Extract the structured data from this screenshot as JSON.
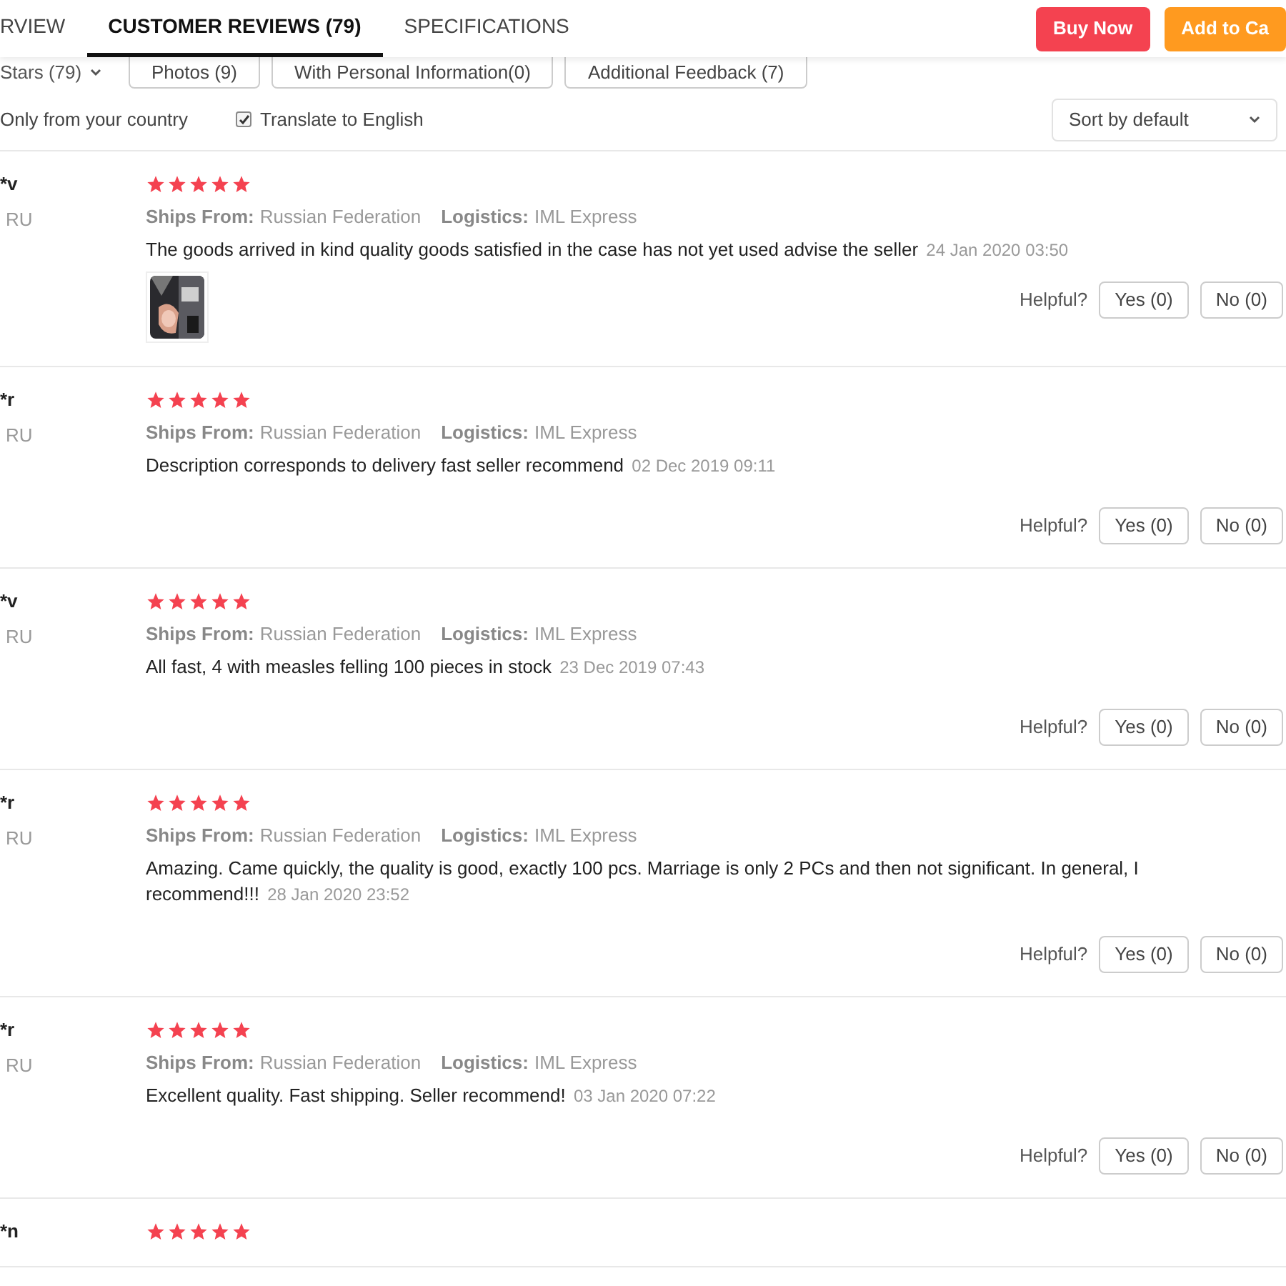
{
  "tabs": [
    {
      "label": "RVIEW",
      "selected": false
    },
    {
      "label": "CUSTOMER REVIEWS (79)",
      "selected": true
    },
    {
      "label": "SPECIFICATIONS",
      "selected": false
    }
  ],
  "actions": [
    {
      "label": "Buy Now",
      "kind": "primary"
    },
    {
      "label": "Add to Ca",
      "kind": "secondary"
    }
  ],
  "filters": {
    "stars_dropdown": "Stars (79)",
    "chips": [
      "Photos (9)",
      "With Personal Information(0)",
      "Additional Feedback (7)"
    ],
    "only_country": "Only from your country",
    "translate": {
      "label": "Translate to English",
      "checked": true
    },
    "sort": "Sort by default"
  },
  "reviews": [
    {
      "name": "*v",
      "country": "RU",
      "stars": 5,
      "ships_label": "Ships From:",
      "ships": "Russian Federation",
      "logistics_label": "Logistics:",
      "logistics": "IML Express",
      "text": "The goods arrived in kind quality goods satisfied in the case has not yet used advise the seller",
      "date": "24 Jan 2020 03:50",
      "photos": [
        {
          "kind": "picture"
        }
      ],
      "helpful": "Helpful?",
      "yes": "Yes (0)",
      "no": "No (0)"
    },
    {
      "name": "*r",
      "country": "RU",
      "stars": 5,
      "ships_label": "Ships From:",
      "ships": "Russian Federation",
      "logistics_label": "Logistics:",
      "logistics": "IML Express",
      "text": "Description corresponds to delivery fast seller recommend",
      "date": "02 Dec 2019 09:11",
      "helpful": "Helpful?",
      "yes": "Yes (0)",
      "no": "No (0)"
    },
    {
      "name": "*v",
      "country": "RU",
      "stars": 5,
      "ships_label": "Ships From:",
      "ships": "Russian Federation",
      "logistics_label": "Logistics:",
      "logistics": "IML Express",
      "text": "All fast, 4 with measles felling 100 pieces in stock",
      "date": "23 Dec 2019 07:43",
      "helpful": "Helpful?",
      "yes": "Yes (0)",
      "no": "No (0)"
    },
    {
      "name": "*r",
      "country": "RU",
      "stars": 5,
      "ships_label": "Ships From:",
      "ships": "Russian Federation",
      "logistics_label": "Logistics:",
      "logistics": "IML Express",
      "text": "Amazing. Came quickly, the quality is good, exactly 100 pcs. Marriage is only 2 PCs and then not significant. In general, I recommend!!!",
      "date": "28 Jan 2020 23:52",
      "helpful": "Helpful?",
      "yes": "Yes (0)",
      "no": "No (0)"
    },
    {
      "name": "*r",
      "country": "RU",
      "stars": 5,
      "ships_label": "Ships From:",
      "ships": "Russian Federation",
      "logistics_label": "Logistics:",
      "logistics": "IML Express",
      "text": "Excellent quality. Fast shipping. Seller recommend!",
      "date": "03 Jan 2020 07:22",
      "helpful": "Helpful?",
      "yes": "Yes (0)",
      "no": "No (0)"
    },
    {
      "name": "*n",
      "stars": 5
    }
  ]
}
